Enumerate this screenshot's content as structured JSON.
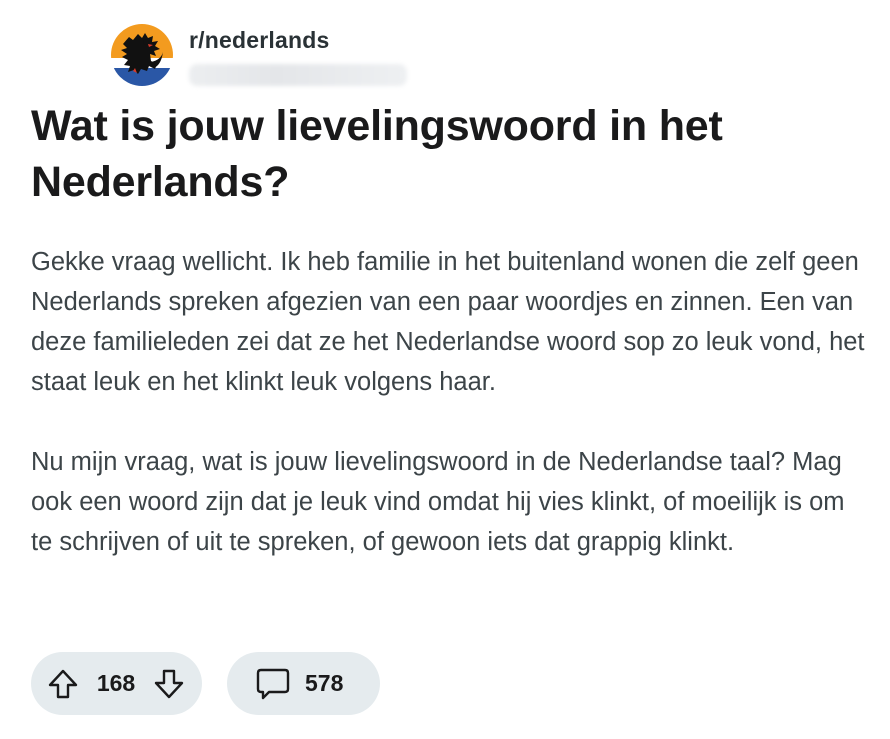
{
  "post": {
    "subreddit": "r/nederlands",
    "title": "Wat is jouw lievelingswoord in het Nederlands?",
    "body": [
      "Gekke vraag wellicht. Ik heb familie in het buitenland wonen die zelf geen Nederlands spreken afgezien van een paar woordjes en zinnen. Een van deze familieleden zei dat ze het Nederlandse woord sop zo leuk vond, het staat leuk en het klinkt leuk volgens haar.",
      "Nu mijn vraag, wat is jouw lievelingswoord in de Nederlandse taal? Mag ook een woord zijn dat je leuk vind omdat hij vies klinkt, of moeilijk is om te schrijven of uit te spreken, of gewoon iets dat grappig klinkt."
    ],
    "votes": "168",
    "comments": "578"
  },
  "icons": {
    "avatar": "flemish-lion-flag-avatar",
    "upvote": "arrow-up-icon",
    "downvote": "arrow-down-icon",
    "comment": "speech-bubble-icon"
  },
  "colors": {
    "pill_background": "#e5ebee",
    "avatar_top": "#f39b1f",
    "avatar_bottom": "#2a57a6",
    "text": "#1a1a1b",
    "body_text": "#3c4448"
  }
}
